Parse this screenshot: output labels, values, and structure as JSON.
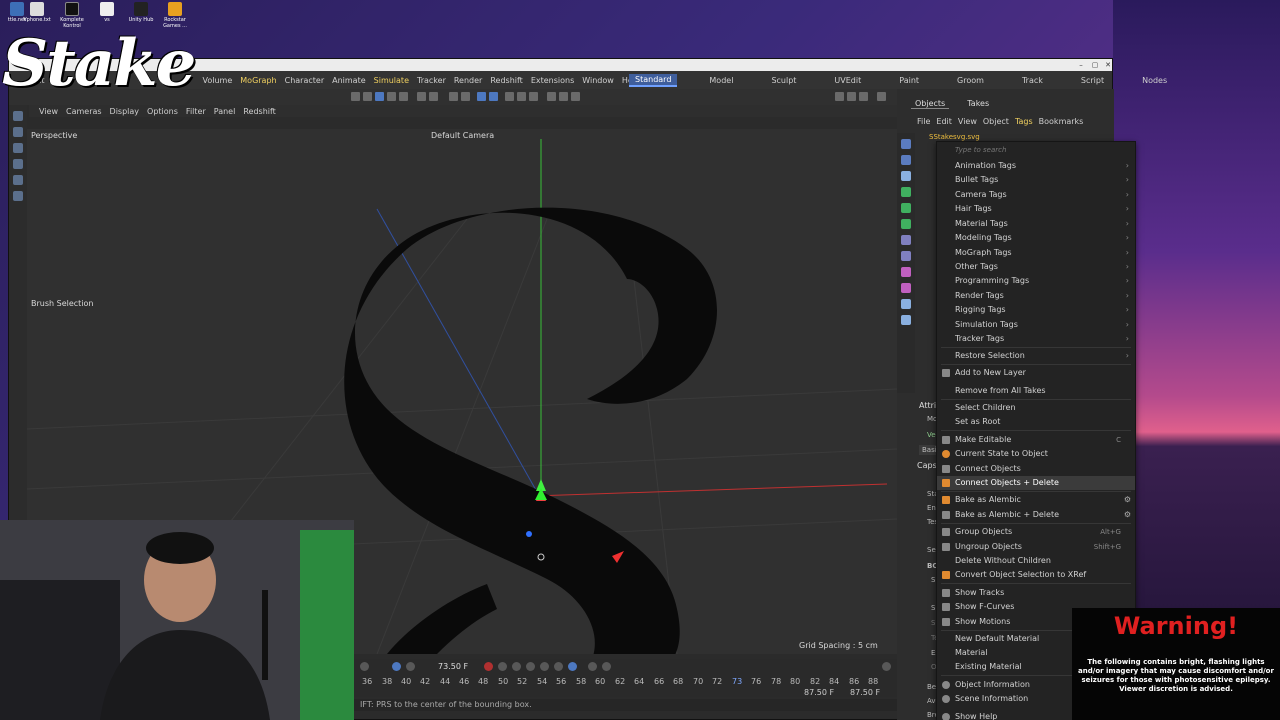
{
  "desktop": {
    "icons": [
      {
        "label": "ttle.net"
      },
      {
        "label": "Vphone.txt"
      },
      {
        "label": "Komplete Kontrol"
      },
      {
        "label": "vs"
      },
      {
        "label": "Unity Hub"
      },
      {
        "label": "Rockstar Games ..."
      }
    ]
  },
  "overlay": {
    "logo_text": "Stake",
    "warning_title": "Warning!",
    "warning_body": "The following contains bright, flashing lights and/or imagery that may cause discomfort and/or seizures for those with photosensitive epilepsy. Viewer discretion is advised."
  },
  "menubar": {
    "items": [
      "Edit",
      "Volume",
      "MoGraph",
      "Character",
      "Animate",
      "Simulate",
      "Tracker",
      "Render",
      "Redshift",
      "Extensions",
      "Window",
      "Help"
    ]
  },
  "layouts": [
    "Standard",
    "Model",
    "Sculpt",
    "UVEdit",
    "Paint",
    "Groom",
    "Track",
    "Script",
    "Nodes"
  ],
  "viewport_menu": [
    "View",
    "Cameras",
    "Display",
    "Options",
    "Filter",
    "Panel",
    "Redshift"
  ],
  "viewport": {
    "name": "Perspective",
    "camera": "Default Camera",
    "brush_label": "Brush Selection",
    "grid_spacing": "Grid Spacing : 5 cm",
    "letter": "S"
  },
  "timeline": {
    "current_frame": "73.50 F",
    "ticks": [
      "36",
      "38",
      "40",
      "42",
      "44",
      "46",
      "48",
      "50",
      "52",
      "54",
      "56",
      "58",
      "60",
      "62",
      "64",
      "66",
      "68",
      "70",
      "72",
      "73",
      "76",
      "78",
      "80",
      "82",
      "84",
      "86",
      "88"
    ],
    "end_a": "87.50 F",
    "end_b": "87.50 F"
  },
  "statusbar": {
    "text": "IFT: PRS to the center of the bounding box."
  },
  "objects_panel": {
    "tabs": [
      "Objects",
      "Takes"
    ],
    "menu": [
      "File",
      "Edit",
      "View",
      "Object",
      "Tags",
      "Bookmarks"
    ],
    "object_name": "SStakesvg.svg"
  },
  "attributes": {
    "title": "Attribu",
    "mode": "Mod",
    "vec": "Vec",
    "basic": "Basic",
    "caps": "Caps an",
    "rows": [
      "Start",
      "End",
      "Tesse",
      "Separ",
      "BOTH",
      "Sha",
      "Size",
      "Subd",
      "Tens",
      "Extr",
      "Offs",
      "Beve",
      "Avoi",
      "Brea"
    ]
  },
  "context_menu": {
    "search_placeholder": "Type to search",
    "items": [
      {
        "label": "Animation Tags",
        "arrow": "›"
      },
      {
        "label": "Bullet Tags",
        "arrow": "›"
      },
      {
        "label": "Camera Tags",
        "arrow": "›"
      },
      {
        "label": "Hair Tags",
        "arrow": "›"
      },
      {
        "label": "Material Tags",
        "arrow": "›"
      },
      {
        "label": "Modeling Tags",
        "arrow": "›"
      },
      {
        "label": "MoGraph Tags",
        "arrow": "›"
      },
      {
        "label": "Other Tags",
        "arrow": "›"
      },
      {
        "label": "Programming Tags",
        "arrow": "›"
      },
      {
        "label": "Render Tags",
        "arrow": "›"
      },
      {
        "label": "Rigging Tags",
        "arrow": "›"
      },
      {
        "label": "Simulation Tags",
        "arrow": "›"
      },
      {
        "label": "Tracker Tags",
        "arrow": "›"
      },
      {
        "label": "Restore Selection",
        "arrow": "›"
      },
      {
        "label": "Add to New Layer"
      },
      {
        "label": "Remove from All Takes"
      },
      {
        "label": "Select Children"
      },
      {
        "label": "Set as Root"
      },
      {
        "label": "Make Editable",
        "shortcut": "C"
      },
      {
        "label": "Current State to Object"
      },
      {
        "label": "Connect Objects"
      },
      {
        "label": "Connect Objects + Delete"
      },
      {
        "label": "Bake as Alembic"
      },
      {
        "label": "Bake as Alembic + Delete"
      },
      {
        "label": "Group Objects",
        "shortcut": "Alt+G"
      },
      {
        "label": "Ungroup Objects",
        "shortcut": "Shift+G"
      },
      {
        "label": "Delete Without Children"
      },
      {
        "label": "Convert Object Selection to XRef"
      },
      {
        "label": "Show Tracks"
      },
      {
        "label": "Show F-Curves"
      },
      {
        "label": "Show Motions"
      },
      {
        "label": "New Default Material"
      },
      {
        "label": "Material"
      },
      {
        "label": "Existing Material"
      },
      {
        "label": "Object Information"
      },
      {
        "label": "Scene Information"
      },
      {
        "label": "Show Help"
      }
    ]
  }
}
